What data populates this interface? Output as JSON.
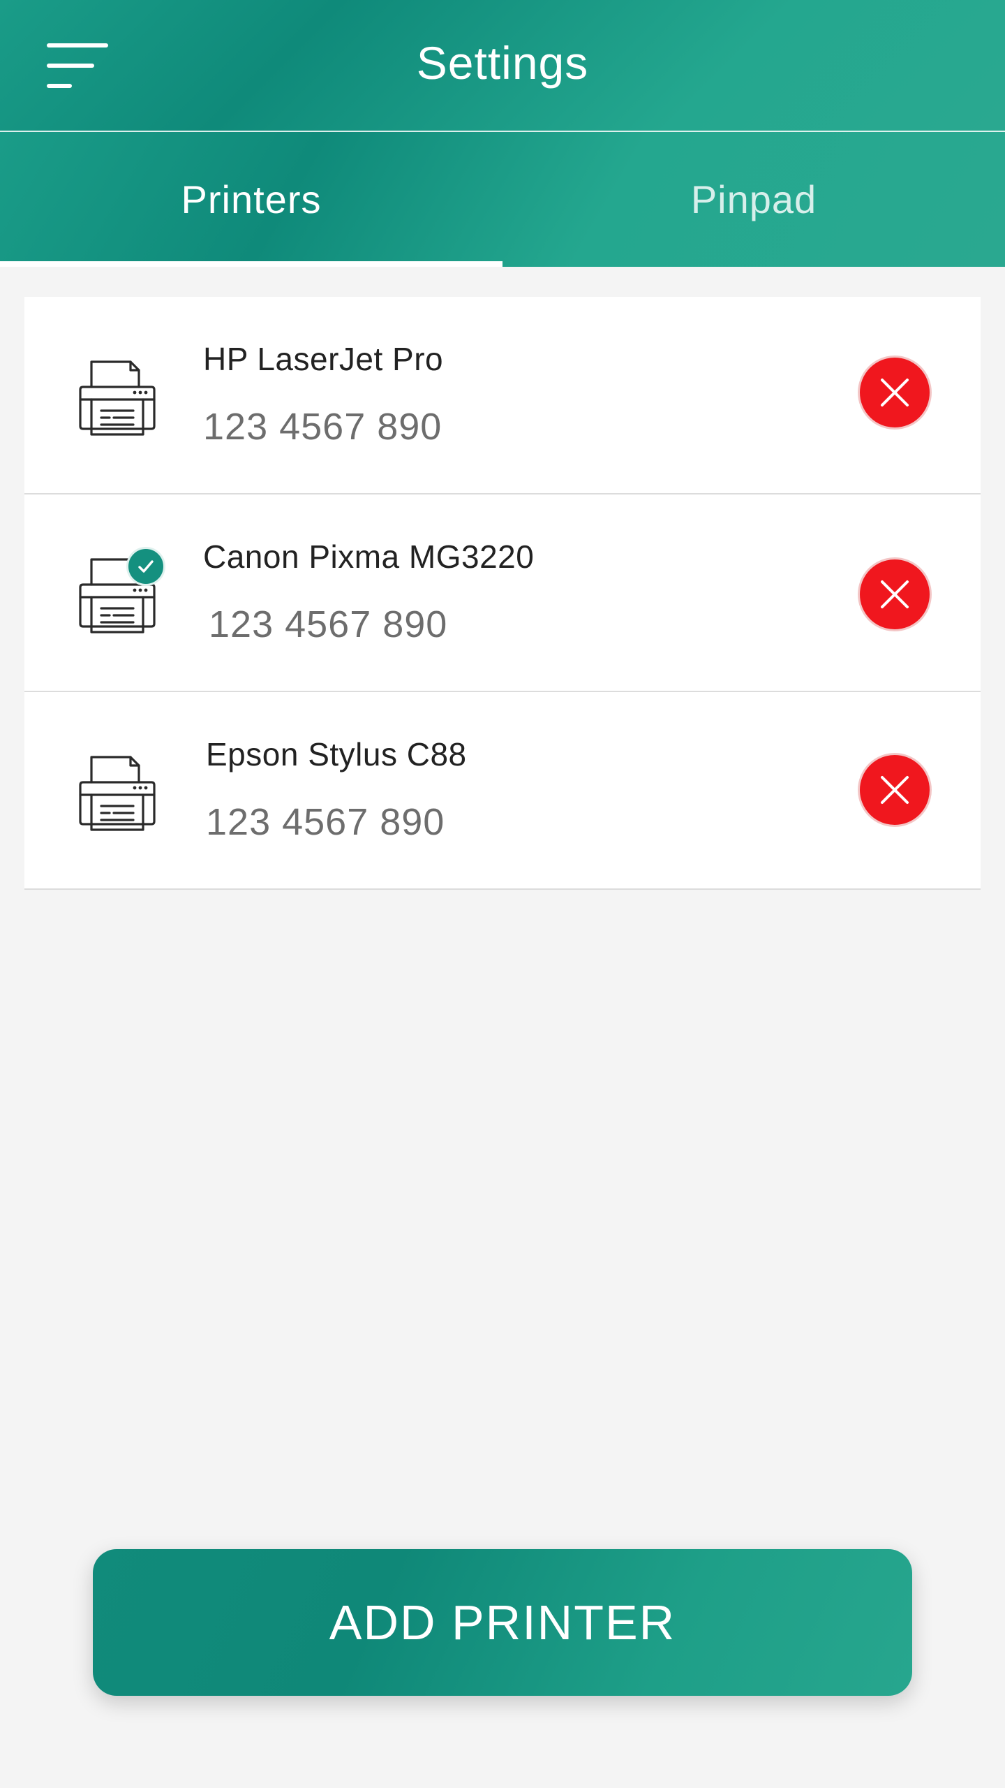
{
  "header": {
    "title": "Settings",
    "menu_icon": "hamburger-menu-icon"
  },
  "tabs": [
    {
      "label": "Printers",
      "active": true
    },
    {
      "label": "Pinpad",
      "active": false
    }
  ],
  "printers": [
    {
      "name": "HP LaserJet Pro",
      "number": "123 4567 890",
      "selected": false,
      "icon": "printer-icon",
      "delete_icon": "close-icon"
    },
    {
      "name": "Canon Pixma MG3220",
      "number": "123 4567 890",
      "selected": true,
      "icon": "printer-icon",
      "delete_icon": "close-icon"
    },
    {
      "name": "Epson Stylus C88",
      "number": "123 4567 890",
      "selected": false,
      "icon": "printer-icon",
      "delete_icon": "close-icon"
    }
  ],
  "footer": {
    "add_button_label": "ADD PRINTER"
  },
  "colors": {
    "primary": "#13917f",
    "delete": "#f0171e",
    "background": "#f4f4f4"
  }
}
